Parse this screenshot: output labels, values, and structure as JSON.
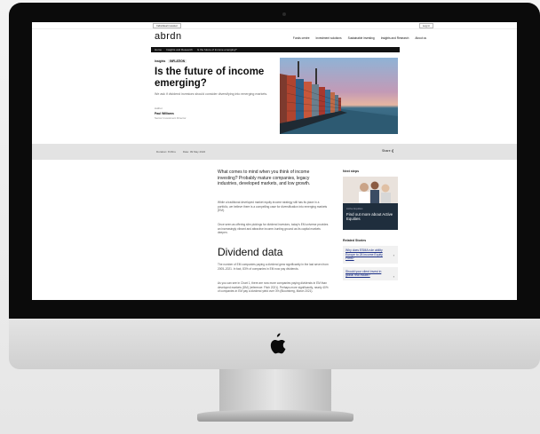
{
  "utility": {
    "selector": "Individual investor",
    "login": "Log in"
  },
  "nav": {
    "logo": "abrdn",
    "links": [
      "Funds centre",
      "Investment solutions",
      "Sustainable investing",
      "Insights and Research",
      "About us"
    ]
  },
  "breadcrumb": [
    "Home",
    "Insights and Research",
    "Is the future of income emerging?"
  ],
  "article": {
    "category": "Insights",
    "tag": "INFLATION",
    "title": "Is the future of income emerging?",
    "subtitle": "We ask if dividend investors should consider diversifying into emerging markets.",
    "author_label": "Author",
    "author_name": "Paul Williams",
    "author_role": "Senior Investment Director",
    "duration": "Duration: 8 Mins",
    "date": "Date: 09 May 2022",
    "share": "Share",
    "lead": "What comes to mind when you think of income investing? Probably mature companies, legacy industries, developed markets, and low growth.",
    "p1": "While a traditional developed market equity income strategy still has its place in a portfolio, we believe there is a compelling case for diversification into emerging markets (EM).",
    "p2": "Once seen as offering slim pickings for dividend investors, today's EM universe provides an increasingly vibrant and attractive income-hunting ground as its capital markets deepen.",
    "heading": "Dividend data",
    "p3": "The number of EM companies paying a dividend grew significantly in the last seven from 2005–2021. In fact, 83% of companies in EM now pay dividends.",
    "p4": "As you can see in Chart 1, there are now more companies paying dividends in EM than developed markets (DM) (reference: Fitch 2021). Perhaps more significantly, nearly 40% of companies in EM pay a dividend yield over 3% (Bloomberg, March 2021)."
  },
  "sidebar": {
    "next_steps": "Next steps",
    "card_kicker": "Active Equities",
    "card_title": "Find out more about Active Equities",
    "related": "Related Stories",
    "stories": [
      "Why does ESMA rule ability Europe to 28 Income Equity Fund?",
      "Should your client invest in global real estate?"
    ]
  }
}
